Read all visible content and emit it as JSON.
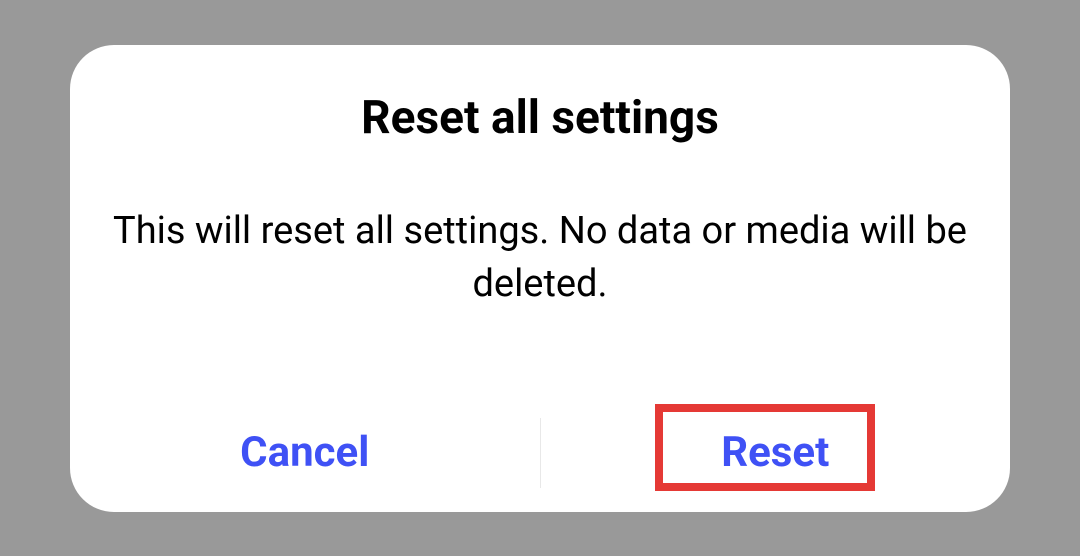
{
  "dialog": {
    "title": "Reset all settings",
    "body": "This will reset all settings. No data or media will be deleted.",
    "actions": {
      "cancel": "Cancel",
      "confirm": "Reset"
    }
  }
}
